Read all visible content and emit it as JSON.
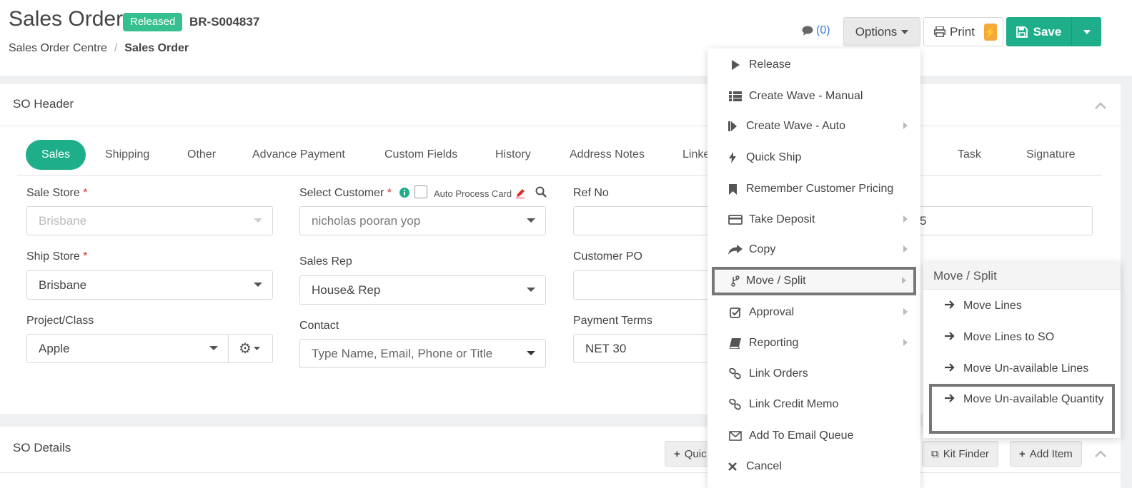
{
  "header": {
    "title": "Sales Order",
    "status": "Released",
    "order_number": "BR-S004837",
    "breadcrumb": [
      "Sales Order Centre",
      "Sales Order"
    ],
    "comments_label": "(0)",
    "options_label": "Options",
    "print_label": "Print",
    "save_label": "Save"
  },
  "so_header": {
    "title": "SO Header",
    "tabs": [
      "Sales",
      "Shipping",
      "Other",
      "Advance Payment",
      "Custom Fields",
      "History",
      "Address Notes",
      "Linke",
      "Task",
      "Signature"
    ],
    "fields": {
      "sale_store": {
        "label": "Sale Store",
        "value": "Brisbane"
      },
      "ship_store": {
        "label": "Ship Store",
        "value": "Brisbane"
      },
      "project_class": {
        "label": "Project/Class",
        "value": "Apple"
      },
      "select_customer": {
        "label": "Select Customer",
        "value": "nicholas pooran yop"
      },
      "auto_process_card": "Auto Process Card",
      "sales_rep": {
        "label": "Sales Rep",
        "value": "House& Rep"
      },
      "contact": {
        "label": "Contact",
        "placeholder": "Type Name, Email, Phone or Title"
      },
      "ref_no": {
        "label": "Ref No",
        "value": ""
      },
      "customer_po": {
        "label": "Customer PO",
        "value": ""
      },
      "payment_terms": {
        "label": "Payment Terms",
        "value": "NET 30"
      },
      "partial_value": "5"
    }
  },
  "so_details": {
    "title": "SO Details",
    "quick_label": "Quic",
    "kit_finder_label": "Kit Finder",
    "add_item_label": "Add Item"
  },
  "options_menu": [
    {
      "label": "Release",
      "icon": "play-icon"
    },
    {
      "label": "Create Wave - Manual",
      "icon": "list-icon"
    },
    {
      "label": "Create Wave - Auto",
      "icon": "step-forward-icon",
      "submenu": true
    },
    {
      "label": "Quick Ship",
      "icon": "bolt-icon"
    },
    {
      "label": "Remember Customer Pricing",
      "icon": "bookmark-icon"
    },
    {
      "label": "Take Deposit",
      "icon": "credit-card-icon",
      "submenu": true
    },
    {
      "label": "Copy",
      "icon": "share-icon",
      "submenu": true
    },
    {
      "label": "Move / Split",
      "icon": "branch-icon",
      "submenu": true,
      "highlighted": true
    },
    {
      "label": "Approval",
      "icon": "check-square-icon",
      "submenu": true
    },
    {
      "label": "Reporting",
      "icon": "book-icon",
      "submenu": true
    },
    {
      "label": "Link Orders",
      "icon": "link-icon"
    },
    {
      "label": "Link Credit Memo",
      "icon": "link-icon"
    },
    {
      "label": "Add To Email Queue",
      "icon": "envelope-icon"
    },
    {
      "label": "Cancel",
      "icon": "times-icon"
    }
  ],
  "move_split_submenu": {
    "title": "Move / Split",
    "items": [
      {
        "label": "Move Lines"
      },
      {
        "label": "Move Lines to SO"
      },
      {
        "label": "Move Un-available Lines"
      },
      {
        "label": "Move Un-available Quantity",
        "highlighted": true
      }
    ]
  }
}
